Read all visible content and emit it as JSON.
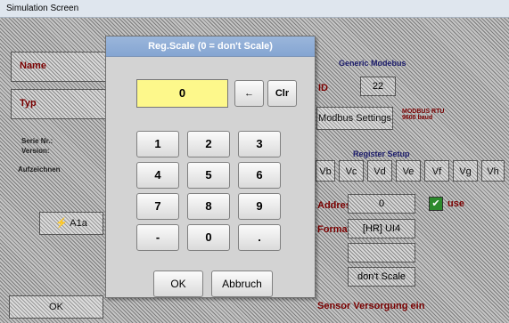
{
  "window": {
    "title": "Simulation Screen"
  },
  "background": {
    "name_label": "Name",
    "typ_label": "Typ",
    "serial_label": "Serie Nr.:",
    "version_label": "Version:",
    "record_label": "Aufzeichnen",
    "channel_label": "A1a",
    "generic_title": "Generic Modebus",
    "id_label": "ID",
    "id_value": "22",
    "bus_settings": "Modbus Settings",
    "register_setup": "Register Setup",
    "value_tabs": [
      "Vb",
      "Vc",
      "Vd",
      "Ve",
      "Vf",
      "Vg",
      "Vh"
    ],
    "address_label": "Address",
    "address_value": "0",
    "use_label": "use",
    "format_label": "Format",
    "format_value": "[HR] UI4",
    "scale_value": "don't Scale",
    "ok_label": "OK",
    "supply_label": "Sensor Versorgung ein"
  },
  "dialog": {
    "title": "Reg.Scale (0 = don't Scale)",
    "display_value": "0",
    "backspace": "←",
    "clear": "Clr",
    "keys": [
      "1",
      "2",
      "3",
      "4",
      "5",
      "6",
      "7",
      "8",
      "9",
      "-",
      "0",
      "."
    ],
    "ok": "OK",
    "cancel": "Abbruch"
  }
}
